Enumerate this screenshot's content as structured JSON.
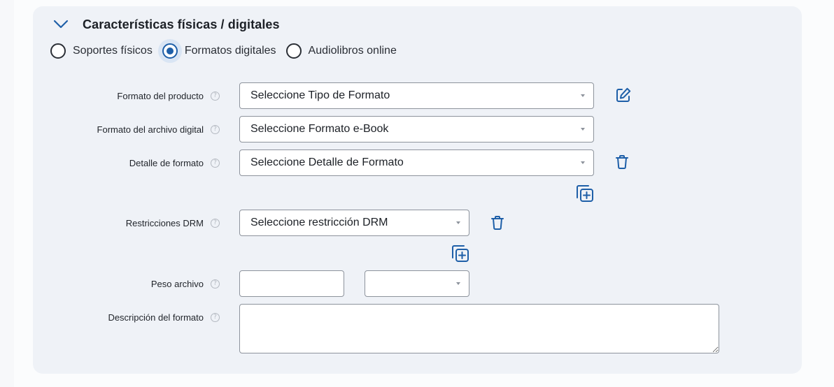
{
  "section": {
    "title": "Características físicas / digitales"
  },
  "radios": [
    {
      "label": "Soportes físicos",
      "selected": false
    },
    {
      "label": "Formatos digitales",
      "selected": true
    },
    {
      "label": "Audiolibros online",
      "selected": false
    }
  ],
  "fields": {
    "formato_producto": {
      "label": "Formato del producto",
      "value": "Seleccione Tipo de Formato"
    },
    "formato_archivo": {
      "label": "Formato del archivo digital",
      "value": "Seleccione Formato e-Book"
    },
    "detalle_formato": {
      "label": "Detalle de formato",
      "value": "Seleccione Detalle de Formato"
    },
    "restricciones_drm": {
      "label": "Restricciones DRM",
      "value": "Seleccione restricción DRM"
    },
    "peso_archivo": {
      "label": "Peso archivo",
      "value": "",
      "unit_value": ""
    },
    "descripcion_formato": {
      "label": "Descripción del formato",
      "value": ""
    }
  },
  "help_glyph": "?",
  "colors": {
    "accent": "#1e5fa8",
    "card_bg": "#eff2f7",
    "border": "#8d939c"
  },
  "icons": [
    "chevron-down-icon",
    "edit-icon",
    "trash-icon",
    "add-copy-icon",
    "help-icon"
  ]
}
